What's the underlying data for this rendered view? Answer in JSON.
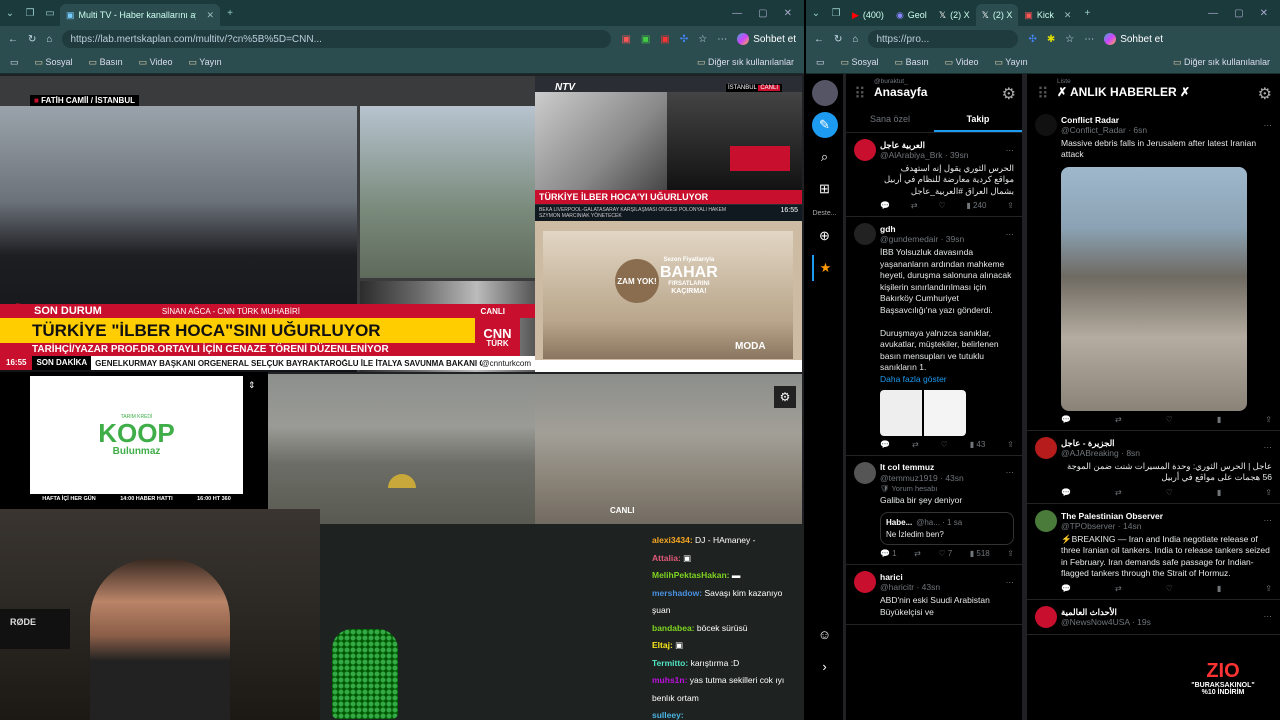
{
  "left_window": {
    "tabs": [
      {
        "label": "Multi TV - Haber kanallarını aynı a",
        "active": true
      }
    ],
    "url": "https://lab.mertskaplan.com/multitv/?cn%5B%5D=CNN...",
    "copilot_label": "Sohbet et",
    "bookmarks": [
      "Sosyal",
      "Basın",
      "Video",
      "Yayın"
    ],
    "bookmarks_other": "Diğer sık kullanılanlar"
  },
  "right_window": {
    "tabs": [
      {
        "label": "(400)"
      },
      {
        "label": "Geol"
      },
      {
        "label": "(2) X"
      },
      {
        "label": "(2) X",
        "active": true
      },
      {
        "label": "Kick"
      }
    ],
    "url": "https://pro...",
    "copilot_label": "Sohbet et",
    "bookmarks": [
      "Sosyal",
      "Basın",
      "Video",
      "Yayın"
    ],
    "bookmarks_other": "Diğer sık kullanılanlar"
  },
  "tv": {
    "cnn": {
      "location": "FATİH CAMİİ / İSTANBUL",
      "son_durum": "SON DURUM",
      "reporter": "SİNAN AĞCA - CNN TÜRK MUHABİRİ",
      "live": "CANLI",
      "headline": "TÜRKİYE \"İLBER HOCA\"SINI UĞURLUYOR",
      "subheadline": "TARİHÇİ/YAZAR PROF.DR.ORTAYLI İÇİN CENAZE TÖRENİ DÜZENLENİYOR",
      "time": "16:55",
      "son_dakika": "SON DAKİKA",
      "ticker": "GENELKURMAY BAŞKANI ORGENERAL SELÇUK BAYRAKTAROĞLU İLE İTALYA SAVUNMA BAKANI GU",
      "handle": "@cnnturkcom",
      "logo_top": "CNN",
      "logo_bottom": "TÜRK"
    },
    "ntv": {
      "logo": "NTV",
      "corner_location": "İSTANBUL",
      "corner_live": "CANLI",
      "headline": "TÜRKİYE İLBER HOCA'YI UĞURLUYOR",
      "ticker": "BEKA LIVERPOOL-GALATASARAY KARŞILAŞMASI ÖNCESİ POLONYALI HAKEM SZYMON MARCINIAK YÖNETECEK",
      "time": "16:55"
    },
    "ad": {
      "badge": "ZAM YOK!",
      "sub": "Sezon Fiyatlarıyla",
      "title": "BAHAR",
      "line1": "FIRSATLARINI",
      "line2": "KAÇIRMA!",
      "brand": "MODA"
    },
    "koop": {
      "tag": "TARIM KREDİ",
      "name": "KOOP",
      "sub": "Bulunmaz",
      "footer": [
        "HAFTA İÇİ HER GÜN",
        "14:00 HABER HATTI",
        "16:00 HT 360"
      ]
    },
    "city_live": "CANLI",
    "rode": "RØDE"
  },
  "chat": [
    {
      "user": "alexi3434:",
      "msg": "DJ - HAmaney -",
      "color": "#f5a623"
    },
    {
      "user": "Attalia:",
      "msg": "▣",
      "color": "#e05a7a"
    },
    {
      "user": "MelihPektasHakan:",
      "msg": "▬",
      "color": "#7ed321"
    },
    {
      "user": "mershadow:",
      "msg": "Savaşı kim kazanıyo şuan",
      "color": "#4a90e2"
    },
    {
      "user": "bandabea:",
      "msg": "böcek sürüsü",
      "color": "#7ed321"
    },
    {
      "user": "Eltaj:",
      "msg": "▣",
      "color": "#f8e71c"
    },
    {
      "user": "Termitto:",
      "msg": "karıştırma :D",
      "color": "#50e3c2"
    },
    {
      "user": "muhs1n:",
      "msg": "yas tutma sekilleri cok ıyı benlık ortam",
      "color": "#bd10e0"
    },
    {
      "user": "sulleey:",
      "msg": "",
      "color": "#4ab3e2"
    }
  ],
  "twitter": {
    "home_user": "@buraktut_",
    "home_title": "Anasayfa",
    "tab_foryou": "Sana özel",
    "tab_following": "Takip",
    "list_label": "Liste",
    "list_title": "✗ ANLIK HABERLER ✗",
    "rail_label": "Deste...",
    "home_tweets": [
      {
        "name": "العربية عاجل",
        "handle": "@AlArabiya_Brk · 39sn",
        "text": "الحرس الثوري يقول إنه استهدف مواقع كردية معارضة للنظام في أربيل بشمال العراق #العربية_عاجل",
        "rtl": true,
        "replies": "",
        "reposts": "",
        "likes": "",
        "views": "240",
        "avatar": "#c8102e"
      },
      {
        "name": "gdh",
        "handle": "@gundemedair · 39sn",
        "text": "İBB Yolsuzluk davasında yaşananların ardından mahkeme heyeti, duruşma salonuna alınacak kişilerin sınırlandırılması için Bakırköy Cumhuriyet Başsavcılığı'na yazı gönderdi.\n\nDuruşmaya yalnızca sanıklar, avukatlar, müştekiler, belirlenen basın mensupları ve tutuklu sanıkların 1.",
        "show_more": "Daha fazla göster",
        "rtl": false,
        "replies": "",
        "reposts": "",
        "likes": "",
        "views": "43",
        "avatar": "#222"
      },
      {
        "name": "It col temmuz",
        "handle": "@temmuz1919 · 43sn",
        "reply_note": "Yorum hesabı",
        "text": "Galiba bir şey deniyor",
        "quote_name": "Habe...",
        "quote_handle": "@ha... · 1 sa",
        "quote_text": "Ne İzledim ben?",
        "rtl": false,
        "replies": "1",
        "reposts": "",
        "likes": "7",
        "views": "518",
        "avatar": "#555"
      },
      {
        "name": "harici",
        "handle": "@haricitr · 43sn",
        "text": "ABD'nin eski Suudi Arabistan Büyükelçisi ve",
        "rtl": false,
        "avatar": "#c8102e"
      }
    ],
    "list_tweets": [
      {
        "name": "Conflict Radar",
        "handle": "@Conflict_Radar · 6sn",
        "text": "Massive debris falls in Jerusalem after latest Iranian attack",
        "avatar": "#111"
      },
      {
        "name": "الجزيرة - عاجل",
        "handle": "@AJABreaking · 8sn",
        "text": "عاجل | الحرس الثوري: وحدة المسيرات شنت ضمن الموجة 56 هجمات على مواقع في أربيل",
        "rtl": true,
        "avatar": "#b71c1c"
      },
      {
        "name": "The Palestinian Observer",
        "handle": "@TPObserver · 14sn",
        "text": "⚡BREAKING — Iran and India negotiate release of three Iranian oil tankers. India to release tankers seized in February. Iran demands safe passage for Indian-flagged tankers through the Strait of Hormuz.",
        "avatar": "#4a7b3a"
      },
      {
        "name": "الأحداث العالمية",
        "handle": "@NewsNow4USA · 19s",
        "text": "",
        "avatar": "#c8102e"
      }
    ],
    "promo_brand": "ZIO",
    "promo_code": "\"BURAKSAKINOL\"",
    "promo_off": "%10 İNDİRİM"
  },
  "colors": {
    "accent": "#1d9bf0",
    "cnn_red": "#c8102e",
    "cnn_yellow": "#ffcd00",
    "koop_green": "#3fae49"
  }
}
